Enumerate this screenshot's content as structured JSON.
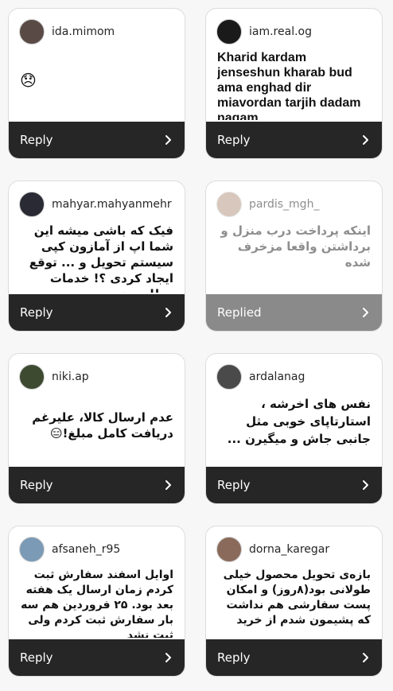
{
  "cards": [
    {
      "username": "ida.mimom",
      "comment": "😞",
      "reply_label": "Reply",
      "avatar_color": "#5a4a46"
    },
    {
      "username": "iam.real.og",
      "comment": "Kharid kardam jenseshun kharab bud ama enghad dir miavordan tarjih dadam nagam",
      "reply_label": "Reply",
      "avatar_color": "#1a1a1a"
    },
    {
      "username": "mahyar.mahyanmehr",
      "comment": "فیک که باشی میشه این شما اپ از آمازون کپی سیستم تحویل و ... توقع ایجاد کردی ؟! خدمات مطلوب نمیدی",
      "reply_label": "Reply",
      "avatar_color": "#2a2a35"
    },
    {
      "username": "pardis_mgh_",
      "comment": "اینکه پرداخت درب منزل و برداشتن واقعا مزخرف شده",
      "reply_label": "Replied",
      "avatar_color": "#b89a86"
    },
    {
      "username": "niki.ap",
      "comment": "عدم ارسال کالا، علیرغم دریافت کامل مبلغ!😑",
      "reply_label": "Reply",
      "avatar_color": "#3d4a30"
    },
    {
      "username": "ardalanag",
      "comment": "نفس های اخرشه ، استارتاپای خوبی مثل جانبی جاش و میگیرن ...",
      "reply_label": "Reply",
      "avatar_color": "#4a4a4a"
    },
    {
      "username": "afsaneh_r95",
      "comment": "اوایل اسفند سفارش ثبت کردم زمان ارسال یک هفته بعد بود. ۲۵ فروردین هم سه بار سفارش ثبت کردم ولی ثبت نشد",
      "reply_label": "Reply",
      "avatar_color": "#7a9ab5"
    },
    {
      "username": "dorna_karegar",
      "comment": "بازه‌ی تحویل محصول خیلی طولانی بود(۸روز) و امکان پست سفارشی هم نداشت که پشیمون شدم از خرید",
      "reply_label": "Reply",
      "avatar_color": "#8a6a5a"
    }
  ]
}
